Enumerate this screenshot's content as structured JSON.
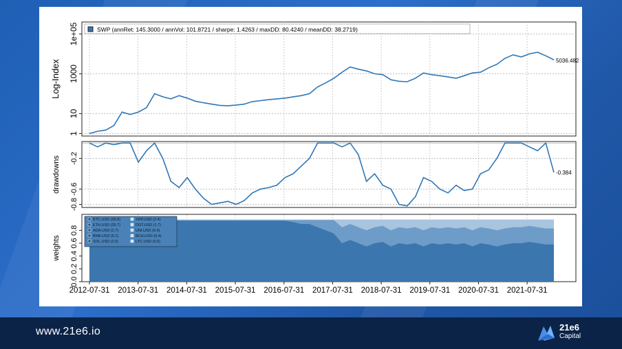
{
  "footer": {
    "url": "www.21e6.io",
    "brand_top": "21e6",
    "brand_bottom": "Capital"
  },
  "colors": {
    "background": "#2a66c0",
    "footer": "#0b2347",
    "line": "#2f76b5",
    "weights_fill": "#3b77ae"
  },
  "chart_data": [
    {
      "type": "line",
      "panel": "index",
      "ylabel": "Log-Index",
      "log_scale": true,
      "ylim": [
        0.75,
        400000
      ],
      "yticks": [
        "1",
        "10",
        "1000",
        "1e+05"
      ],
      "legend_text": "SWP (annRet: 145.3000 / annVol: 101.8721 / sharpe: 1.4263 / maxDD: 80.4240 / meanDD: 38.2719)",
      "legend_placement": "top-left",
      "end_label": "5036.482",
      "grid": true,
      "x": [
        "2012-07",
        "2012-09",
        "2012-11",
        "2013-01",
        "2013-03",
        "2013-05",
        "2013-07",
        "2013-09",
        "2013-11",
        "2014-01",
        "2014-03",
        "2014-05",
        "2014-07",
        "2014-09",
        "2014-11",
        "2015-01",
        "2015-03",
        "2015-05",
        "2015-07",
        "2015-09",
        "2015-11",
        "2016-01",
        "2016-03",
        "2016-05",
        "2016-07",
        "2016-09",
        "2016-11",
        "2017-01",
        "2017-03",
        "2017-05",
        "2017-07",
        "2017-09",
        "2017-11",
        "2018-01",
        "2018-03",
        "2018-05",
        "2018-07",
        "2018-09",
        "2018-11",
        "2019-01",
        "2019-03",
        "2019-05",
        "2019-07",
        "2019-09",
        "2019-11",
        "2020-01",
        "2020-03",
        "2020-05",
        "2020-07",
        "2020-09",
        "2020-11",
        "2021-01",
        "2021-03",
        "2021-05",
        "2021-07",
        "2021-09",
        "2021-11",
        "2022-01"
      ],
      "values": [
        1,
        1.3,
        1.5,
        2.5,
        12,
        9,
        12,
        20,
        100,
        70,
        55,
        80,
        60,
        42,
        35,
        30,
        26,
        25,
        27,
        30,
        40,
        45,
        50,
        55,
        60,
        70,
        80,
        100,
        220,
        350,
        600,
        1200,
        2200,
        1700,
        1400,
        1000,
        900,
        500,
        420,
        400,
        600,
        1100,
        900,
        800,
        700,
        600,
        800,
        1100,
        1200,
        2000,
        3000,
        6000,
        9000,
        7000,
        10000,
        12000,
        8000,
        5036.482
      ]
    },
    {
      "type": "line",
      "panel": "drawdowns",
      "ylabel": "drawdowns",
      "ylim": [
        -0.84,
        0.02
      ],
      "yticks": [
        "-0.8",
        "-0.6",
        "-0.2"
      ],
      "end_label": "-0.384",
      "grid": true,
      "values": [
        0,
        -0.05,
        0,
        -0.02,
        0,
        0,
        -0.25,
        -0.1,
        0,
        -0.2,
        -0.5,
        -0.58,
        -0.45,
        -0.6,
        -0.72,
        -0.8,
        -0.78,
        -0.76,
        -0.8,
        -0.75,
        -0.65,
        -0.6,
        -0.58,
        -0.55,
        -0.45,
        -0.4,
        -0.3,
        -0.2,
        0,
        0,
        0,
        -0.05,
        0,
        -0.15,
        -0.5,
        -0.4,
        -0.55,
        -0.6,
        -0.8,
        -0.82,
        -0.7,
        -0.45,
        -0.5,
        -0.6,
        -0.65,
        -0.55,
        -0.62,
        -0.6,
        -0.4,
        -0.35,
        -0.2,
        0,
        0,
        0,
        -0.05,
        -0.1,
        0,
        -0.384
      ]
    },
    {
      "type": "area",
      "panel": "weights",
      "ylabel": "weights",
      "ylim": [
        0,
        1.0
      ],
      "yticks": [
        "0.0",
        "0.2",
        "0.4",
        "0.6",
        "0.8"
      ],
      "legend_placement": "top-left",
      "legend": [
        {
          "name": "BTC.USD (58.8)"
        },
        {
          "name": "ETH.USD (25.7)"
        },
        {
          "name": "ADA.USD (2.7)"
        },
        {
          "name": "BNB.USD (5.1)"
        },
        {
          "name": "SOL.USD (2.5)"
        },
        {
          "name": "XRP.USD (2.4)"
        },
        {
          "name": "DOT.USD (1.7)"
        },
        {
          "name": "UNI.USD (0.4)"
        },
        {
          "name": "BCH.USD (0.4)"
        },
        {
          "name": "LTC.USD (0.6)"
        }
      ],
      "series_btc_values": [
        0.95,
        0.95,
        0.95,
        0.95,
        0.95,
        0.95,
        0.95,
        0.95,
        0.95,
        0.95,
        0.95,
        0.95,
        0.95,
        0.95,
        0.95,
        0.95,
        0.95,
        0.95,
        0.95,
        0.95,
        0.95,
        0.95,
        0.95,
        0.95,
        0.95,
        0.93,
        0.9,
        0.9,
        0.85,
        0.8,
        0.75,
        0.6,
        0.65,
        0.6,
        0.55,
        0.6,
        0.62,
        0.55,
        0.6,
        0.58,
        0.6,
        0.55,
        0.6,
        0.58,
        0.6,
        0.58,
        0.6,
        0.55,
        0.6,
        0.58,
        0.55,
        0.58,
        0.6,
        0.6,
        0.62,
        0.6,
        0.58,
        0.58
      ],
      "xticks": [
        "2012-07-31",
        "2013-07-31",
        "2014-07-31",
        "2015-07-31",
        "2016-07-31",
        "2017-07-31",
        "2018-07-31",
        "2019-07-31",
        "2020-07-31",
        "2021-07-31"
      ]
    }
  ]
}
